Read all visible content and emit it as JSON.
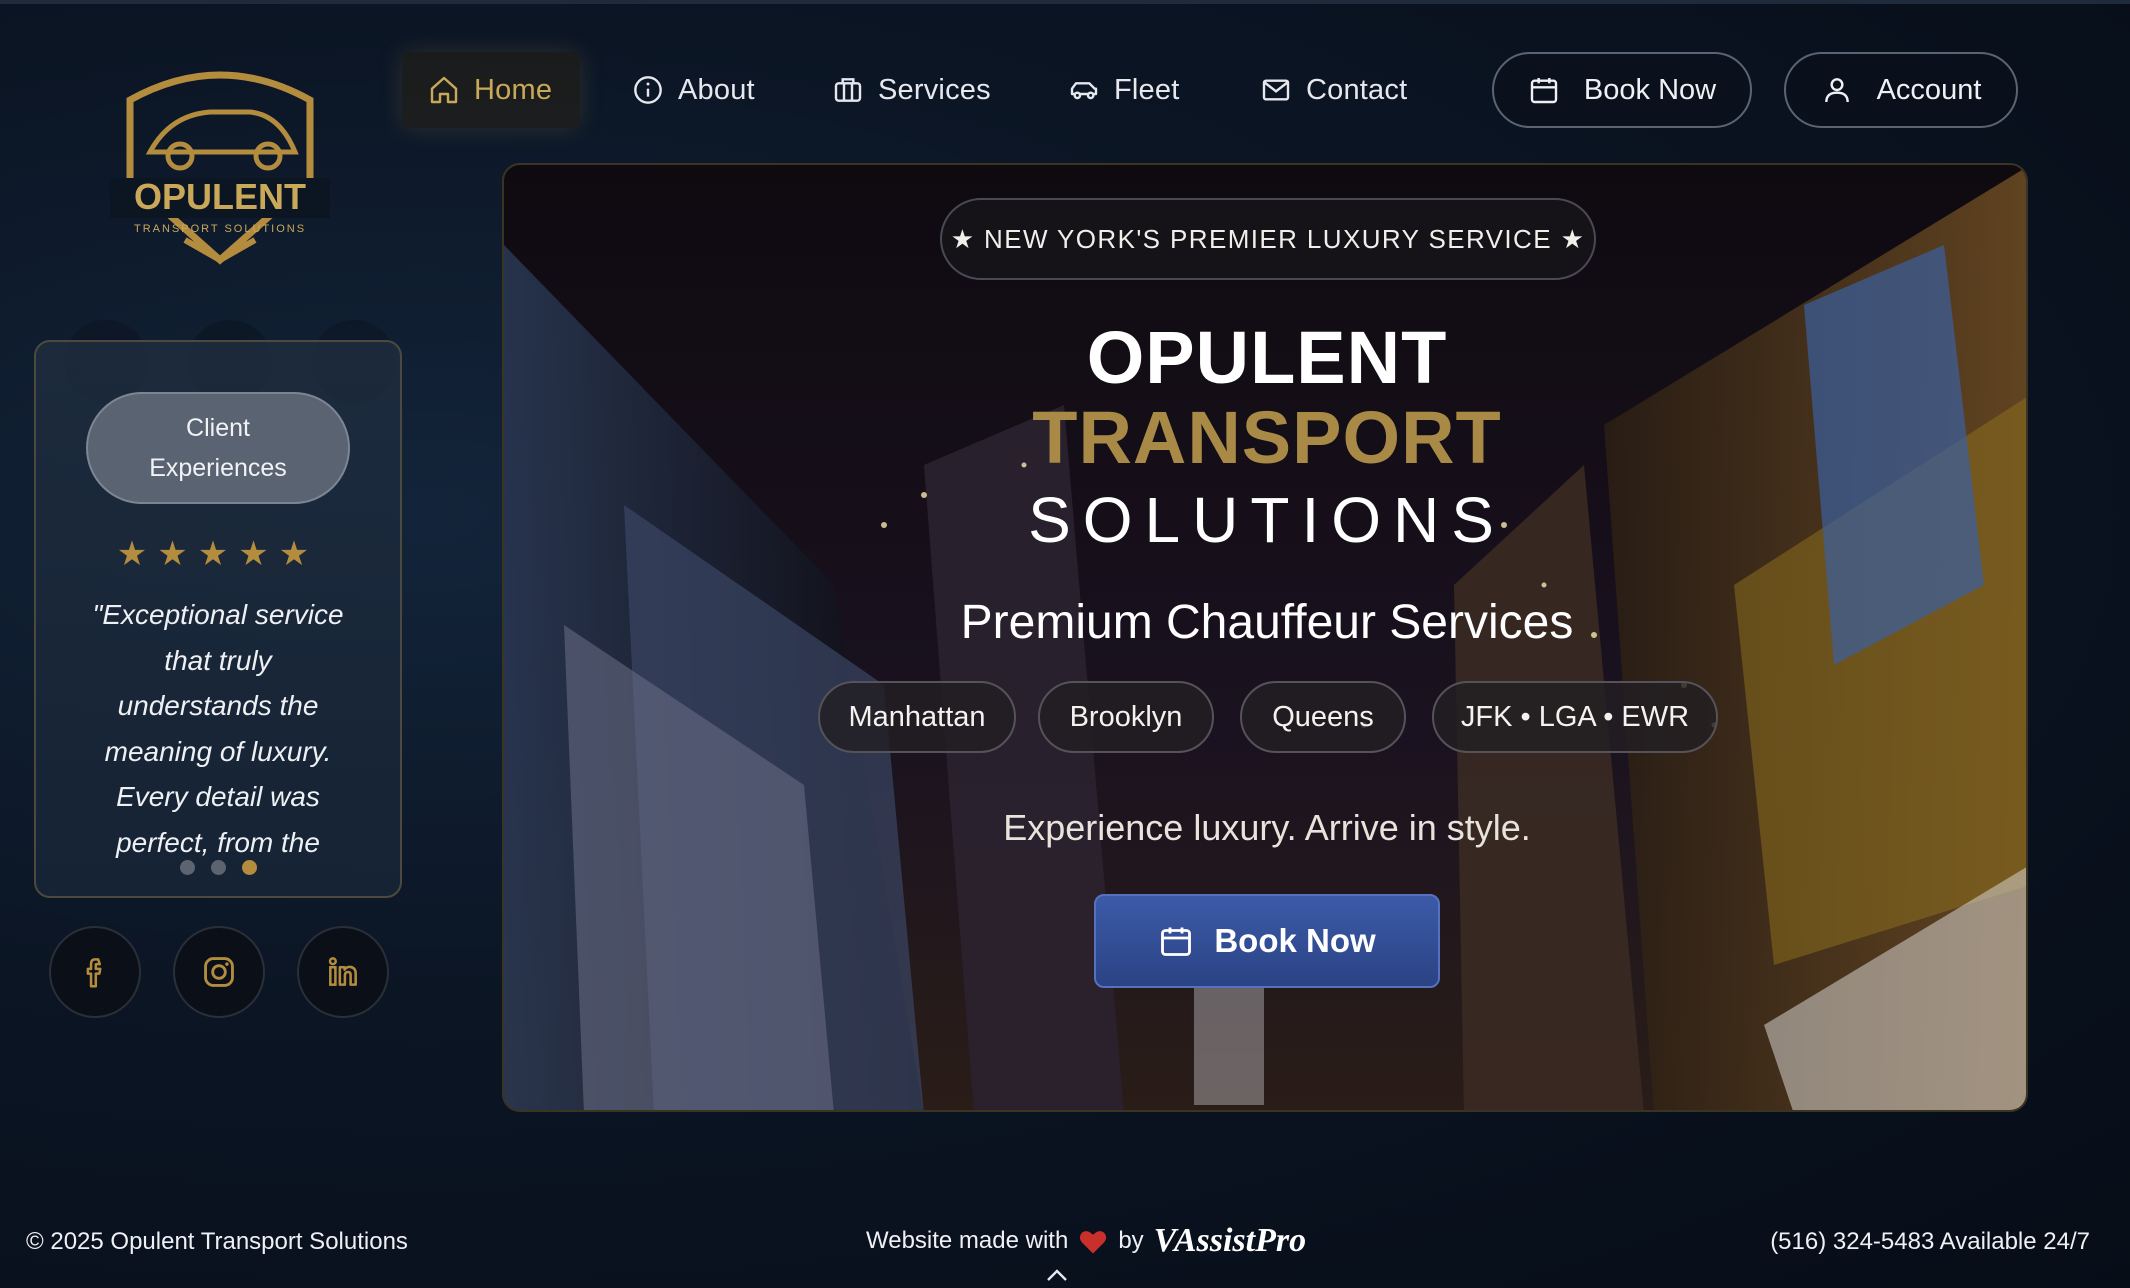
{
  "brand": {
    "logo_name": "OPULENT",
    "logo_sub": "TRANSPORT SOLUTIONS",
    "gold": "#b48c3e",
    "navy": "#0b1524"
  },
  "nav": {
    "items": [
      {
        "label": "Home",
        "icon": "home-icon",
        "active": true
      },
      {
        "label": "About",
        "icon": "info-icon"
      },
      {
        "label": "Services",
        "icon": "briefcase-icon"
      },
      {
        "label": "Fleet",
        "icon": "car-icon"
      },
      {
        "label": "Contact",
        "icon": "mail-icon"
      }
    ],
    "book_now": "Book Now",
    "account": "Account"
  },
  "sidebar": {
    "title": "Client Experiences",
    "stars": "★★★★★",
    "rating": 5,
    "quote": "\"Exceptional service that truly understands the meaning of luxury. Every detail was perfect, from the",
    "dots": 3,
    "active_dot": 2,
    "social": [
      "facebook-icon",
      "instagram-icon",
      "linkedin-icon"
    ]
  },
  "hero": {
    "badge": "★ NEW YORK'S PREMIER LUXURY SERVICE ★",
    "title_1": "OPULENT",
    "title_2": "TRANSPORT",
    "title_3": "SOLUTIONS",
    "subtitle": "Premium Chauffeur Services",
    "locations": [
      "Manhattan",
      "Brooklyn",
      "Queens",
      "JFK • LGA • EWR"
    ],
    "tagline": "Experience luxury. Arrive in style.",
    "cta": "Book Now"
  },
  "footer": {
    "copyright": "© 2025 Opulent Transport Solutions",
    "made_with": "Website made with",
    "by": "by",
    "credit": "VAssistPro",
    "phone": "(516) 324-5483 Available 24/7"
  }
}
